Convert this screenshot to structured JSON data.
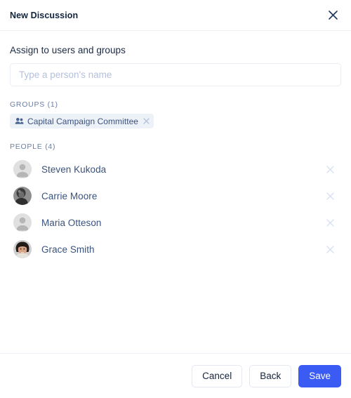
{
  "header": {
    "title": "New Discussion",
    "close_icon": "close-icon"
  },
  "form": {
    "assign_label": "Assign to users and groups",
    "input_value": "",
    "input_placeholder": "Type a person's name"
  },
  "groups": {
    "section_label": "GROUPS (1)",
    "items": [
      {
        "name": "Capital Campaign Committee",
        "icon": "people-group-icon",
        "remove_icon": "close-small-icon"
      }
    ]
  },
  "people": {
    "section_label": "PEOPLE (4)",
    "items": [
      {
        "name": "Steven Kukoda",
        "avatar": "default-avatar",
        "remove_icon": "close-small-icon"
      },
      {
        "name": "Carrie Moore",
        "avatar": "photo-avatar-dark",
        "remove_icon": "close-small-icon"
      },
      {
        "name": "Maria Otteson",
        "avatar": "default-avatar",
        "remove_icon": "close-small-icon"
      },
      {
        "name": "Grace Smith",
        "avatar": "photo-avatar-light",
        "remove_icon": "close-small-icon"
      }
    ]
  },
  "footer": {
    "cancel_label": "Cancel",
    "back_label": "Back",
    "save_label": "Save"
  },
  "colors": {
    "primary": "#3b5bf5",
    "title_text": "#12243d",
    "name_text": "#3a527d",
    "section_text": "#6b7fa3",
    "chip_bg": "#edf1f8",
    "placeholder": "#b4c0dd",
    "divider": "#edf0f5"
  }
}
